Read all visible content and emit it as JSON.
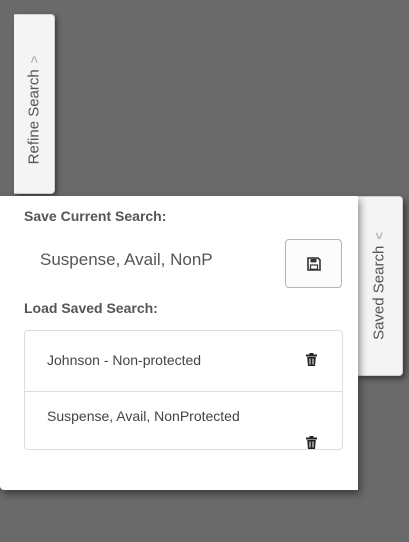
{
  "refine_tab": {
    "label": "Refine Search",
    "chevron": ">"
  },
  "saved_tab": {
    "label": "Saved Search",
    "chevron": "<"
  },
  "save_section": {
    "label": "Save Current Search:",
    "input_value": "Suspense, Avail, NonP",
    "save_icon": "floppy-disk-icon"
  },
  "load_section": {
    "label": "Load Saved Search:",
    "items": [
      {
        "label": "Johnson - Non-protected",
        "icon": "trash-icon"
      },
      {
        "label": "Suspense, Avail, NonProtected",
        "icon": "trash-icon"
      }
    ]
  }
}
